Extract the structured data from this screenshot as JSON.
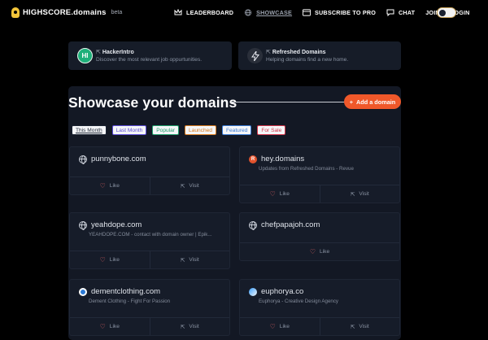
{
  "nav": {
    "brand": "HIGHSCORE.domains",
    "beta": "beta",
    "links": [
      {
        "label": "LEADERBOARD",
        "icon": "crown-icon"
      },
      {
        "label": "SHOWCASE",
        "icon": "globe-icon"
      },
      {
        "label": "SUBSCRIBE TO PRO",
        "icon": "card-icon"
      },
      {
        "label": "CHAT",
        "icon": "chat-icon"
      },
      {
        "label": "JOIN",
        "icon": ""
      },
      {
        "label": "LOGIN",
        "icon": ""
      }
    ]
  },
  "promos": [
    {
      "title": "HackerIntro",
      "subtitle": "Discover the most relevant job oppurtunities.",
      "avatar_text": "HI",
      "color": "#1fb07a"
    },
    {
      "title": "Refreshed Domains",
      "subtitle": "Helping domains find a new home.",
      "avatar_text": "",
      "color": "#2a2f3a"
    }
  ],
  "main": {
    "title": "Showcase your domains",
    "add_button": "Add a domain",
    "filters": [
      {
        "label": "This Month",
        "color": "#1c2433"
      },
      {
        "label": "Last Month",
        "color": "#5b4bd6"
      },
      {
        "label": "Popular",
        "color": "#1f9e6b"
      },
      {
        "label": "Launched",
        "color": "#d77a1e"
      },
      {
        "label": "Featured",
        "color": "#3a7bd5"
      },
      {
        "label": "For Sale",
        "color": "#d2354a"
      }
    ],
    "cards": [
      {
        "domain": "punnybone.com",
        "description": "",
        "icon": "globe-icon",
        "like": "Like",
        "visit": "Visit"
      },
      {
        "domain": "hey.domains",
        "description": "Updates from Refreshed Domains - Revue",
        "icon": "revue-logo-icon",
        "like": "Like",
        "visit": "Visit"
      },
      {
        "domain": "yeahdope.com",
        "description": "YEAHDOPE.COM - contact with domain owner | Epik...",
        "icon": "globe-icon",
        "like": "Like",
        "visit": "Visit"
      },
      {
        "domain": "chefpapajoh.com",
        "description": "",
        "icon": "globe-icon",
        "like": "Like",
        "visit": ""
      },
      {
        "domain": "dementclothing.com",
        "description": "Dement Clothing - Fight For Passion",
        "icon": "dement-logo-icon",
        "like": "Like",
        "visit": "Visit"
      },
      {
        "domain": "euphorya.co",
        "description": "Euphorya - Creative Design Agency",
        "icon": "euphorya-logo-icon",
        "like": "Like",
        "visit": "Visit"
      }
    ]
  }
}
